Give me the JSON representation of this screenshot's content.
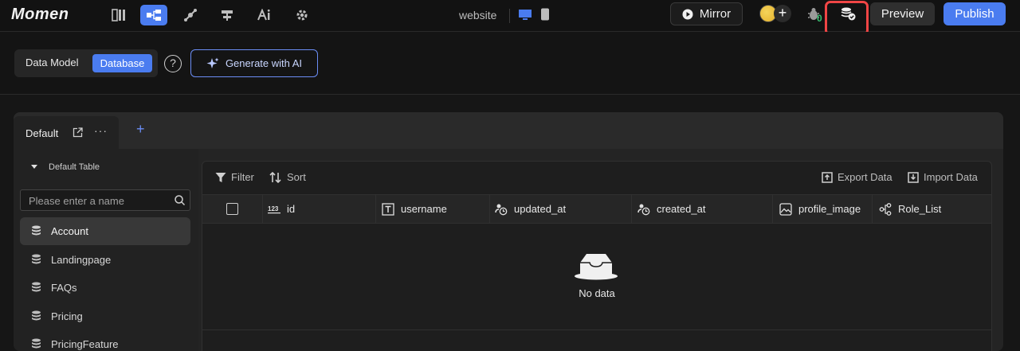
{
  "app": {
    "logo": "Momen",
    "site_name": "website"
  },
  "topbar": {
    "mirror_label": "Mirror",
    "bug_count": "0",
    "preview_label": "Preview",
    "publish_label": "Publish"
  },
  "subbar": {
    "data_model_label": "Data Model",
    "database_label": "Database",
    "help_label": "?",
    "generate_label": "Generate with AI"
  },
  "tabs": {
    "default_label": "Default",
    "add_label": "+"
  },
  "sidebar": {
    "section_label": "Default Table",
    "search_placeholder": "Please enter a name",
    "items": [
      {
        "label": "Account",
        "active": true
      },
      {
        "label": "Landingpage"
      },
      {
        "label": "FAQs"
      },
      {
        "label": "Pricing"
      },
      {
        "label": "PricingFeature"
      }
    ]
  },
  "toolbar": {
    "filter_label": "Filter",
    "sort_label": "Sort",
    "export_label": "Export Data",
    "import_label": "Import Data"
  },
  "table": {
    "columns": [
      "id",
      "username",
      "updated_at",
      "created_at",
      "profile_image",
      "Role_List"
    ],
    "empty_text": "No data"
  },
  "colors": {
    "accent": "#4a7cf0",
    "highlight": "#f04545",
    "success": "#38c172"
  }
}
